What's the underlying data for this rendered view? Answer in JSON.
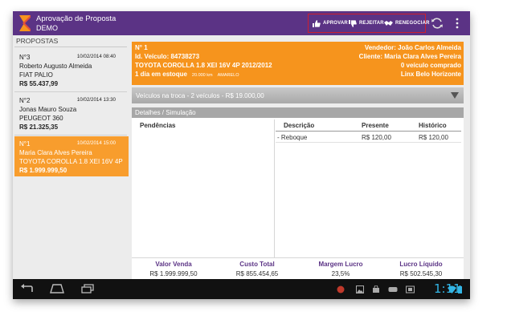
{
  "app": {
    "title": "Aprovação de Proposta",
    "subtitle": "DEMO",
    "logo_icon": "app-logo-icon",
    "accent_color": "#5b3385",
    "actions": [
      {
        "label": "APROVAR",
        "icon": "thumbs-up-icon"
      },
      {
        "label": "REJEITAR",
        "icon": "thumbs-down-icon"
      },
      {
        "label": "RENEGOCIAR",
        "icon": "handshake-icon"
      }
    ],
    "refresh_icon": "refresh-icon",
    "overflow_icon": "overflow-menu-icon"
  },
  "sidebar": {
    "header": "PROPOSTAS",
    "items": [
      {
        "number": "N°3",
        "date": "10/02/2014 08:40",
        "client": "Roberto Augusto Almeida",
        "vehicle": "FIAT PALIO",
        "value": "R$ 55.437,99",
        "selected": false
      },
      {
        "number": "N°2",
        "date": "10/02/2014 13:30",
        "client": "Jonas Mauro Souza",
        "vehicle": "PEUGEOT 360",
        "value": "R$ 21.325,35",
        "selected": false
      },
      {
        "number": "N°1",
        "date": "10/02/2014 15:00",
        "client": "Maria Clara Alves Pereira",
        "vehicle": "TOYOTA COROLLA 1.8 XEI 16V 4P",
        "value": "R$ 1.999.999,50",
        "selected": true
      }
    ],
    "selected_color": "#f89d2d"
  },
  "detail": {
    "number": "N° 1",
    "vehicle_id": "Id. Veículo: 84738273",
    "vehicle_desc": "TOYOTA COROLLA 1.8 XEI 16V 4P  2012/2012",
    "stock_days": "1 dia em estoque",
    "mileage": "20.000 km",
    "color": "AMARELO",
    "seller": "Vendedor:  João Carlos Almeida",
    "client": "Cliente:  Maria Clara Alves Pereira",
    "purchased": "0  veículo comprado",
    "store": "Linx Belo Horizonte",
    "header_color": "#f6941d"
  },
  "trade": {
    "text": "Veículos na troca - 2 veículos - R$ 19.000,00",
    "arrow_icon": "dropdown-triangle-icon"
  },
  "details_section": {
    "title": "Detalhes / Simulação",
    "pendencias_title": "Pendências",
    "table": {
      "headers": [
        "Descrição",
        "Presente",
        "Histórico"
      ],
      "rows": [
        {
          "descricao": "- Reboque",
          "presente": "R$ 120,00",
          "historico": "R$ 120,00"
        }
      ]
    }
  },
  "summary": [
    {
      "label": "Valor Venda",
      "value": "R$ 1.999.999,50"
    },
    {
      "label": "Custo Total",
      "value": "R$ 855.454,65"
    },
    {
      "label": "Margem Lucro",
      "value": "23,5%"
    },
    {
      "label": "Lucro Líquido",
      "value": "R$ 502.545,30"
    }
  ],
  "system_bar": {
    "time": "1:11",
    "nav_icons": [
      "back-icon",
      "home-icon",
      "recent-apps-icon"
    ],
    "status_icons": [
      "notification-app-icon",
      "gallery-icon",
      "store-icon",
      "gamepad-icon",
      "screenshot-icon",
      "wifi-icon",
      "battery-icon"
    ]
  }
}
